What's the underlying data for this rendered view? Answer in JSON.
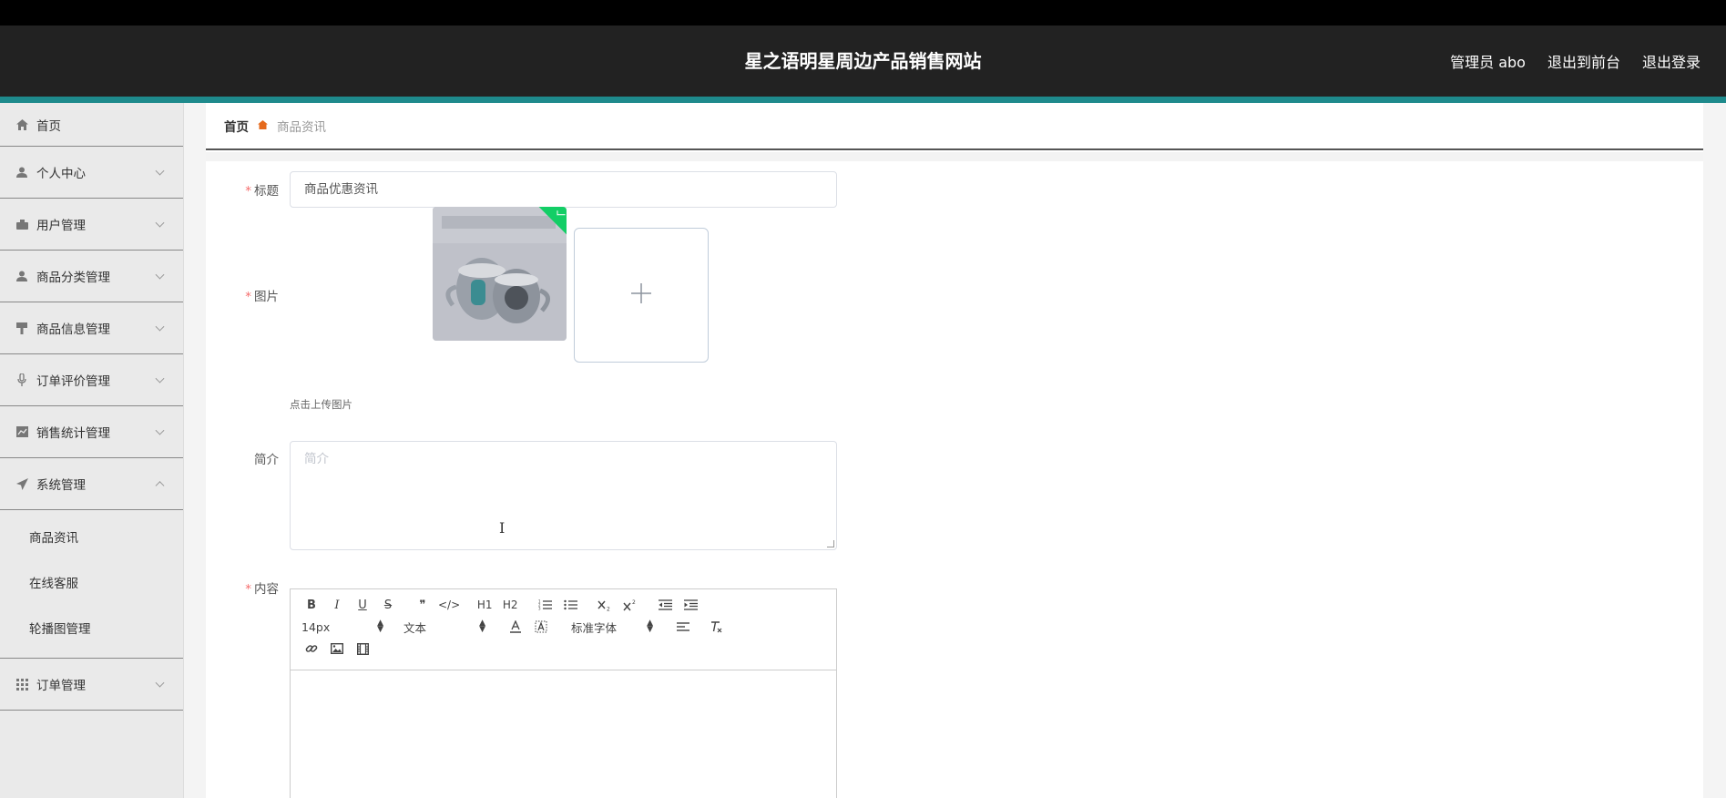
{
  "header": {
    "site_title": "星之语明星周边产品销售网站",
    "admin_label": "管理员 abo",
    "to_front_label": "退出到前台",
    "logout_label": "退出登录"
  },
  "sidebar": {
    "items": [
      {
        "label": "首页",
        "icon": "home-icon"
      },
      {
        "label": "个人中心",
        "icon": "person-icon"
      },
      {
        "label": "用户管理",
        "icon": "user-card-icon"
      },
      {
        "label": "商品分类管理",
        "icon": "user-icon"
      },
      {
        "label": "商品信息管理",
        "icon": "brush-icon"
      },
      {
        "label": "订单评价管理",
        "icon": "microphone-icon"
      },
      {
        "label": "销售统计管理",
        "icon": "chart-icon"
      },
      {
        "label": "系统管理",
        "icon": "send-icon"
      },
      {
        "label": "订单管理",
        "icon": "grid-icon"
      }
    ],
    "system_submenu": [
      "商品资讯",
      "在线客服",
      "轮播图管理"
    ]
  },
  "breadcrumb": {
    "home": "首页",
    "current": "商品资讯"
  },
  "form": {
    "title_label": "标题",
    "title_value": "商品优惠资讯",
    "image_label": "图片",
    "upload_tip": "点击上传图片",
    "intro_label": "简介",
    "intro_placeholder": "简介",
    "content_label": "内容",
    "required_mark": "*"
  },
  "editor": {
    "font_size": "14px",
    "header_select": "文本",
    "font_family": "标准字体",
    "buttons": [
      "B",
      "I",
      "U",
      "S",
      "❞",
      "</>",
      "H1",
      "H2"
    ]
  },
  "colors": {
    "header_bg": "#222222",
    "accent_stripe": "#1e8a8c",
    "required": "#f56c6c",
    "success": "#13ce66"
  }
}
